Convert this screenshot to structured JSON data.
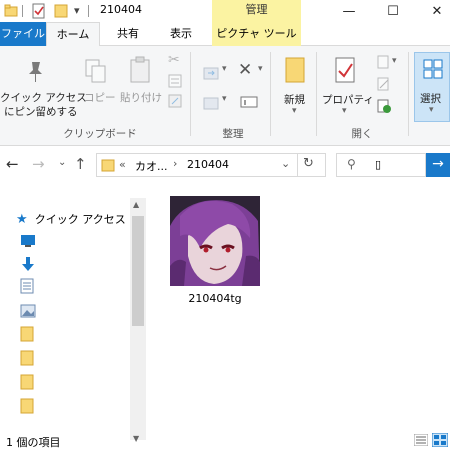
{
  "titlebar": {
    "title": "210404",
    "manage_label": "管理",
    "minimize": "—",
    "maximize": "☐",
    "close": "✕"
  },
  "tabs": {
    "file": "ファイル",
    "home": "ホーム",
    "share": "共有",
    "view": "表示",
    "picture_tools": "ピクチャ ツール"
  },
  "ribbon": {
    "pin_label_1": "クイック アクセス",
    "pin_label_2": "にピン留めする",
    "copy_label": "コピー",
    "paste_label": "貼り付け",
    "clipboard_group": "クリップボード",
    "organize_group": "整理",
    "new_label": "新規",
    "properties_label": "プロパティ",
    "open_group": "開く",
    "select_label": "選択"
  },
  "address": {
    "prefix": "«",
    "segment1": "カオ...",
    "segment2": "210404",
    "search_cursor": "▯"
  },
  "nav": {
    "quick_access": "クイック アクセス"
  },
  "file": {
    "name": "210404tg"
  },
  "status": {
    "count": "1 個の項目"
  },
  "colors": {
    "accent": "#1979ca",
    "manage_tab": "#fbf3a2",
    "folder": "#f8d775"
  }
}
